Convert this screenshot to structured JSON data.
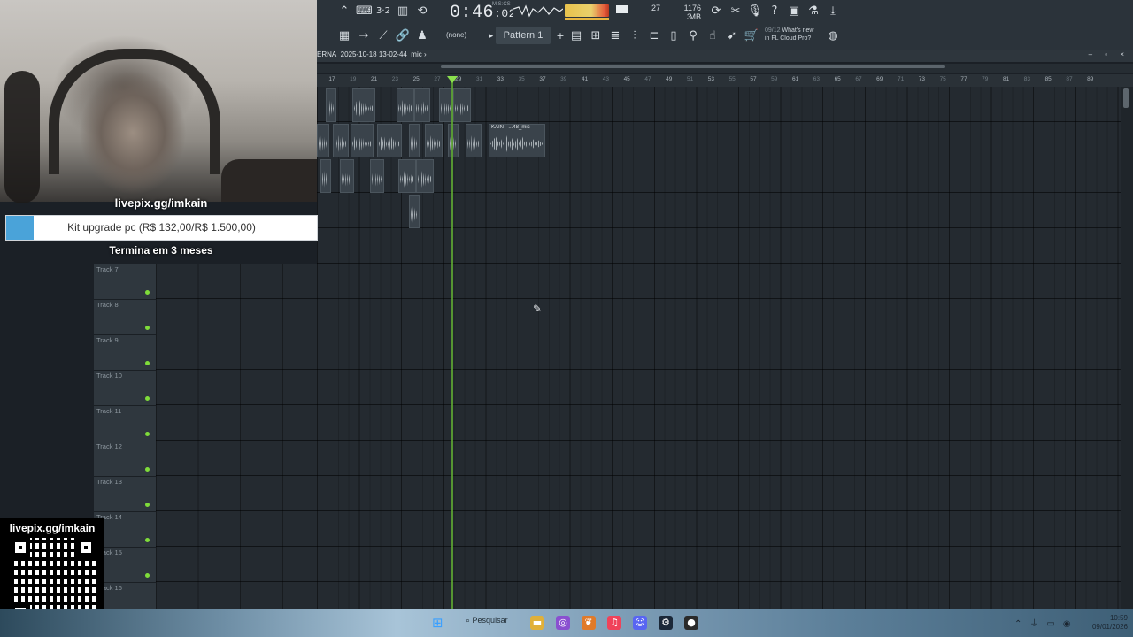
{
  "toolbar": {
    "time": "0:46",
    "time_small": ":02",
    "time_label": "M:S:CS",
    "cpu": "27",
    "memory": "1176 MB",
    "memory_sub": "3",
    "pattern_none": "(none)",
    "pattern_label": "Pattern 1",
    "cloud_news_num": "09/12",
    "cloud_news_text1": "What's new",
    "cloud_news_text2": "in FL Cloud Pro?"
  },
  "playlist": {
    "title": "ERNA_2025-10-18 13-02-44_mic ›",
    "window_controls": "– ▫ ×",
    "ruler": [
      "17",
      "19",
      "21",
      "23",
      "25",
      "27",
      "29",
      "31",
      "33",
      "35",
      "37",
      "39",
      "41",
      "43",
      "45",
      "47",
      "49",
      "51",
      "53",
      "55",
      "57",
      "59",
      "61",
      "63",
      "65",
      "67",
      "69",
      "71",
      "73",
      "75",
      "77",
      "79",
      "81",
      "83",
      "85",
      "87",
      "89"
    ],
    "clip_label": "KAIN - ...48_mic",
    "tracks": [
      "Track 7",
      "Track 8",
      "Track 9",
      "Track 10",
      "Track 11",
      "Track 12",
      "Track 13",
      "Track 14",
      "Track 15",
      "Track 16"
    ]
  },
  "overlay": {
    "donation_url": "livepix.gg/imkain",
    "donation_label": "Kit upgrade pc (R$ 132,00/R$ 1.500,00)",
    "donation_progress": 0.088,
    "donation_ends": "Termina em 3 meses",
    "qr_label": "livepix.gg/imkain"
  },
  "taskbar": {
    "search": "Pesquisar",
    "time": "10:59",
    "date": "09/01/2026"
  },
  "colors": {
    "playhead": "#5ea832",
    "track_led": "#7fdc3a",
    "donation_fill": "#4aa3d9"
  }
}
